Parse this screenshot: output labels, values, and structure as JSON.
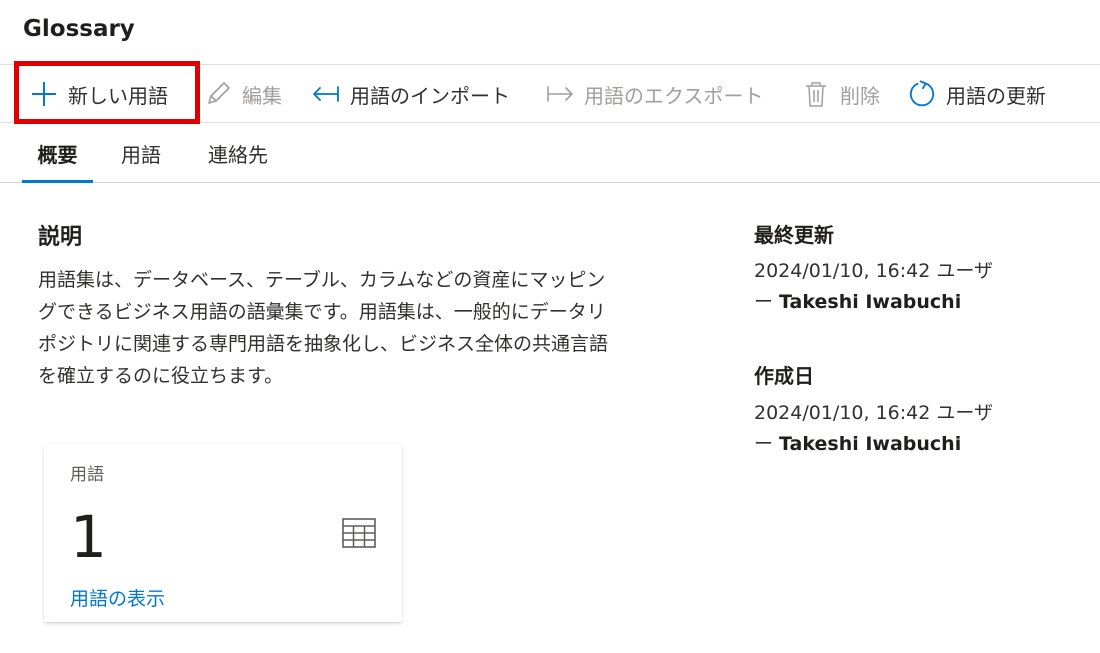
{
  "page": {
    "title": "Glossary"
  },
  "toolbar": {
    "new_term": "新しい用語",
    "edit": "編集",
    "import": "用語のインポート",
    "export": "用語のエクスポート",
    "delete": "削除",
    "refresh": "用語の更新"
  },
  "tabs": [
    {
      "label": "概要",
      "active": true
    },
    {
      "label": "用語",
      "active": false
    },
    {
      "label": "連絡先",
      "active": false
    }
  ],
  "description": {
    "heading": "説明",
    "lines": [
      "用語集は、データベース、テーブル、カラムなどの資産にマッピン",
      "グできるビジネス用語の語彙集です。用語集は、一般的にデータリ",
      "ポジトリに関連する専門用語を抽象化し、ビジネス全体の共通言語",
      "を確立するのに役立ちます。"
    ]
  },
  "card": {
    "label": "用語",
    "count": "1",
    "link": "用語の表示",
    "icon": "table-icon"
  },
  "last_updated": {
    "heading": "最終更新",
    "line1": "2024/01/10, 16:42 ユーザ",
    "line2_prefix": "ー ",
    "user": "Takeshi Iwabuchi"
  },
  "created": {
    "heading": "作成日",
    "line1": "2024/01/10, 16:42 ユーザ",
    "line2_prefix": "ー ",
    "user": "Takeshi Iwabuchi"
  },
  "colors": {
    "accent": "#0078d4",
    "highlight": "#e00000",
    "disabled": "#a19f9d"
  }
}
